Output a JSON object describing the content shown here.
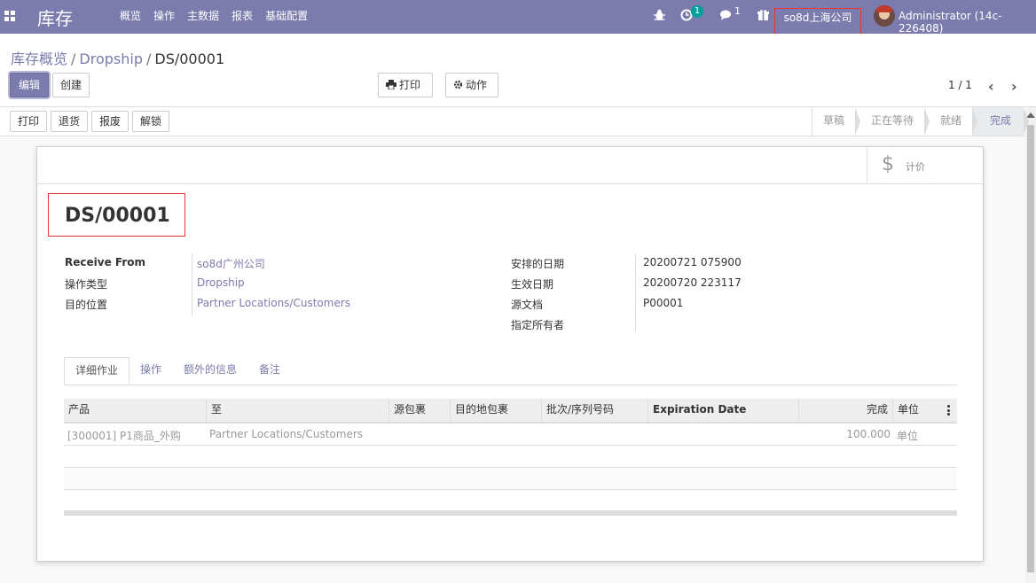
{
  "navbar": {
    "brand": "库存",
    "menu": [
      "概览",
      "操作",
      "主数据",
      "报表",
      "基础配置"
    ],
    "activity_count": "1",
    "chat_count": "1",
    "company": "so8d上海公司",
    "user": "Administrator (14c-226408)"
  },
  "breadcrumb": {
    "root": "库存概览",
    "sep1": "/",
    "middle": "Dropship",
    "sep2": "/",
    "current": "DS/00001"
  },
  "actions": {
    "edit": "编辑",
    "create": "创建",
    "print": "打印",
    "action": "动作"
  },
  "pager": {
    "value": "1 / 1"
  },
  "status_buttons": [
    "打印",
    "退货",
    "报废",
    "解锁"
  ],
  "stages": [
    {
      "label": "草稿",
      "active": false
    },
    {
      "label": "正在等待",
      "active": false
    },
    {
      "label": "就绪",
      "active": false
    },
    {
      "label": "完成",
      "active": true
    }
  ],
  "stat_button": {
    "label": "计价",
    "icon": "dollar-icon"
  },
  "record": {
    "title": "DS/00001",
    "left_fields": [
      {
        "label": "Receive From",
        "value": "so8d广州公司"
      },
      {
        "label": "操作类型",
        "value": "Dropship"
      },
      {
        "label": "目的位置",
        "value": "Partner Locations/Customers"
      }
    ],
    "right_fields": [
      {
        "label": "安排的日期",
        "value": "20200721 075900"
      },
      {
        "label": "生效日期",
        "value": "20200720 223117"
      },
      {
        "label": "源文档",
        "value": "P00001"
      },
      {
        "label": "指定所有者",
        "value": ""
      }
    ]
  },
  "tabs": [
    "详细作业",
    "操作",
    "额外的信息",
    "备注"
  ],
  "table": {
    "headers": [
      "产品",
      "至",
      "源包裹",
      "目的地包裹",
      "批次/序列号码",
      "Expiration Date",
      "完成",
      "单位"
    ],
    "rows": [
      [
        "[300001] P1商品_外购",
        "Partner Locations/Customers",
        "",
        "",
        "",
        "",
        "100.000",
        "单位"
      ]
    ]
  },
  "colors": {
    "brand": "#7c7bad",
    "highlight_box": "#ee3333"
  }
}
